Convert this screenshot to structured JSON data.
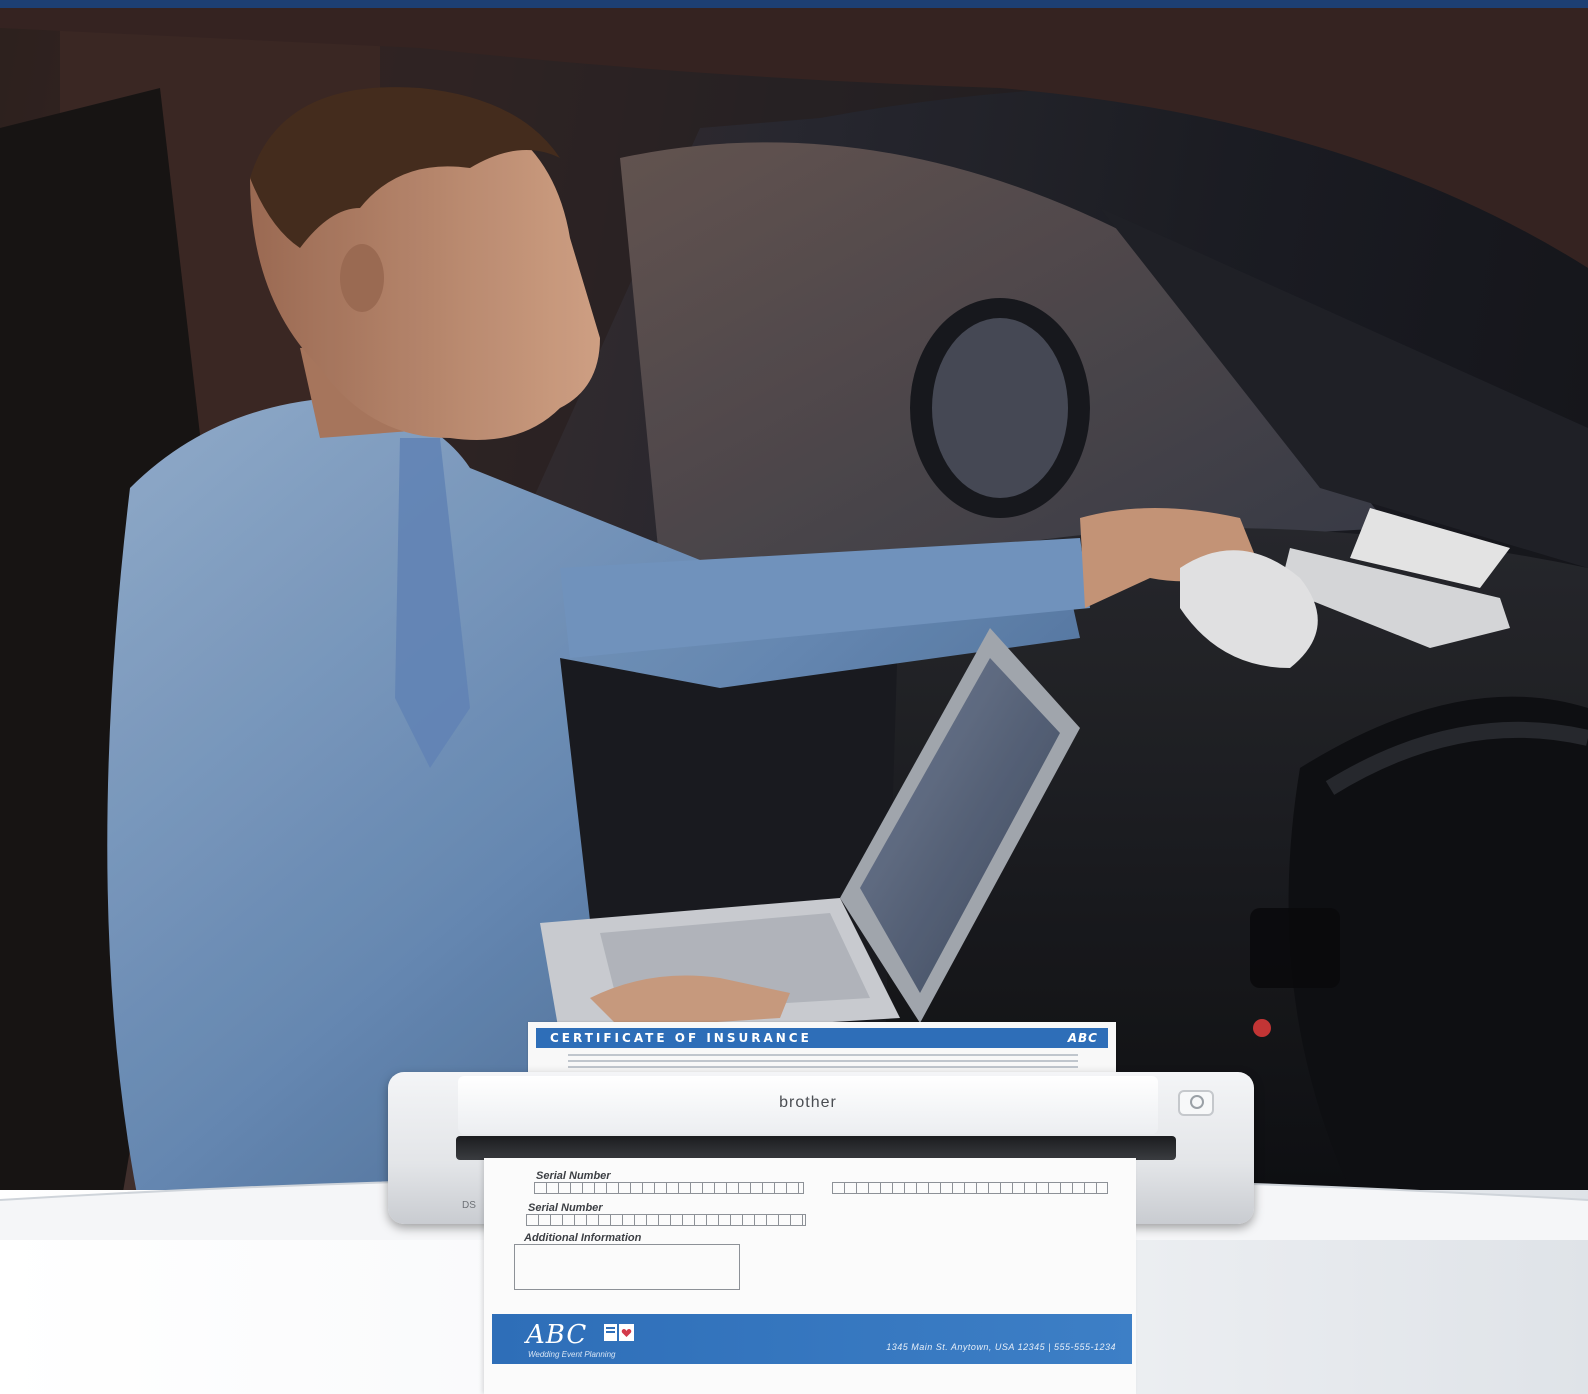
{
  "scene": {
    "description_colors": {
      "brand_strip": "#1d3f73",
      "document_blue": "#2e6eb8",
      "shirt_blue": "#7ea1c9"
    }
  },
  "certificate": {
    "title": "CERTIFICATE OF INSURANCE",
    "brand": "ABC"
  },
  "scanner": {
    "logo": "brother",
    "model": "DS"
  },
  "form": {
    "serial_label_1": "Serial Number",
    "serial_label_2": "Serial Number",
    "additional_label": "Additional Information"
  },
  "footer": {
    "logo": "ABC",
    "tagline": "Wedding Event Planning",
    "address": "1345 Main St. Anytown, USA 12345 | 555-555-1234"
  }
}
